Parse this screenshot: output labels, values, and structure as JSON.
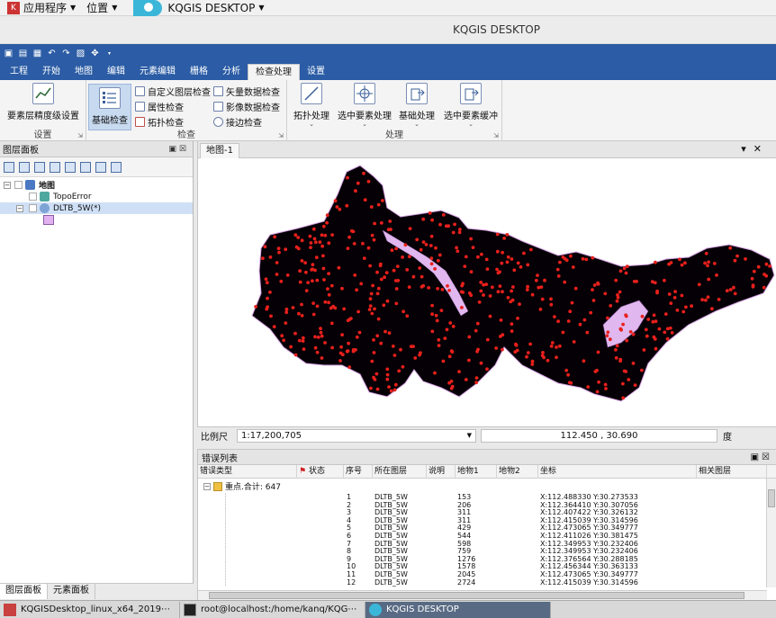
{
  "system_bar": {
    "applications": "应用程序",
    "places": "位置",
    "app_name": "KQGIS DESKTOP"
  },
  "window_title": "KQGIS DESKTOP",
  "ribbon_tabs": [
    {
      "label": "工程"
    },
    {
      "label": "开始"
    },
    {
      "label": "地图"
    },
    {
      "label": "编辑"
    },
    {
      "label": "元素编辑"
    },
    {
      "label": "栅格"
    },
    {
      "label": "分析"
    },
    {
      "label": "检查处理"
    },
    {
      "label": "设置"
    }
  ],
  "active_tab_index": 7,
  "ribbon": {
    "settings_group": {
      "label": "设置",
      "button": "要素层精度级设置"
    },
    "check_group": {
      "label": "检查",
      "basic_check": "基础检查",
      "custom_layer_check": "自定义图层检查",
      "attribute_check": "属性检查",
      "topology_check": "拓扑检查",
      "vector_data_check": "矢量数据检查",
      "image_data_check": "影像数据检查",
      "edge_check": "接边检查"
    },
    "process_group": {
      "label": "处理",
      "topology_process": "拓扑处理",
      "selected_feature_process": "选中要素处理",
      "basic_process": "基础处理",
      "selected_feature_buffer": "选中要素缓冲"
    }
  },
  "layer_panel": {
    "title": "图层面板",
    "tree": {
      "root": "地图",
      "layer1": "TopoError",
      "layer2": "DLTB_5W(*)"
    },
    "bottom_tabs": [
      "图层面板",
      "元素面板"
    ]
  },
  "map": {
    "tab": "地图-1"
  },
  "scale": {
    "label": "比例尺",
    "value": "1:17,200,705",
    "coordinates": "112.450 , 30.690",
    "unit": "度"
  },
  "error_list": {
    "title": "错误列表",
    "columns": [
      "错误类型",
      "状态",
      "序号",
      "所在图层",
      "说明",
      "地物1",
      "地物2",
      "坐标",
      "相关图层"
    ],
    "group_label": "重点.合计: 647",
    "rows": [
      {
        "seq": "1",
        "layer": "DLTB_5W",
        "f1": "153",
        "coord": "X:112.488330 Y:30.273533"
      },
      {
        "seq": "2",
        "layer": "DLTB_5W",
        "f1": "206",
        "coord": "X:112.364410 Y:30.307056"
      },
      {
        "seq": "3",
        "layer": "DLTB_5W",
        "f1": "311",
        "coord": "X:112.407422 Y:30.326132"
      },
      {
        "seq": "4",
        "layer": "DLTB_5W",
        "f1": "311",
        "coord": "X:112.415039 Y:30.314596"
      },
      {
        "seq": "5",
        "layer": "DLTB_5W",
        "f1": "429",
        "coord": "X:112.473065 Y:30.349777"
      },
      {
        "seq": "6",
        "layer": "DLTB_5W",
        "f1": "544",
        "coord": "X:112.411026 Y:30.381475"
      },
      {
        "seq": "7",
        "layer": "DLTB_5W",
        "f1": "598",
        "coord": "X:112.349953 Y:30.232406"
      },
      {
        "seq": "8",
        "layer": "DLTB_5W",
        "f1": "759",
        "coord": "X:112.349953 Y:30.232406"
      },
      {
        "seq": "9",
        "layer": "DLTB_5W",
        "f1": "1276",
        "coord": "X:112.376564 Y:30.288185"
      },
      {
        "seq": "10",
        "layer": "DLTB_5W",
        "f1": "1578",
        "coord": "X:112.456344 Y:30.363133"
      },
      {
        "seq": "11",
        "layer": "DLTB_5W",
        "f1": "2045",
        "coord": "X:112.473065 Y:30.349777"
      },
      {
        "seq": "12",
        "layer": "DLTB_5W",
        "f1": "2724",
        "coord": "X:112.415039 Y:30.314596"
      }
    ]
  },
  "taskbar": [
    {
      "label": "KQGISDesktop_linux_x64_2019⋯"
    },
    {
      "label": "root@localhost:/home/kanq/KQG⋯"
    },
    {
      "label": "KQGIS DESKTOP"
    }
  ],
  "colors": {
    "ribbon_blue": "#2b5ca5",
    "feature_fill": "#000000",
    "polygon_edge": "#d9a6e8",
    "error_point": "#e8201c"
  }
}
